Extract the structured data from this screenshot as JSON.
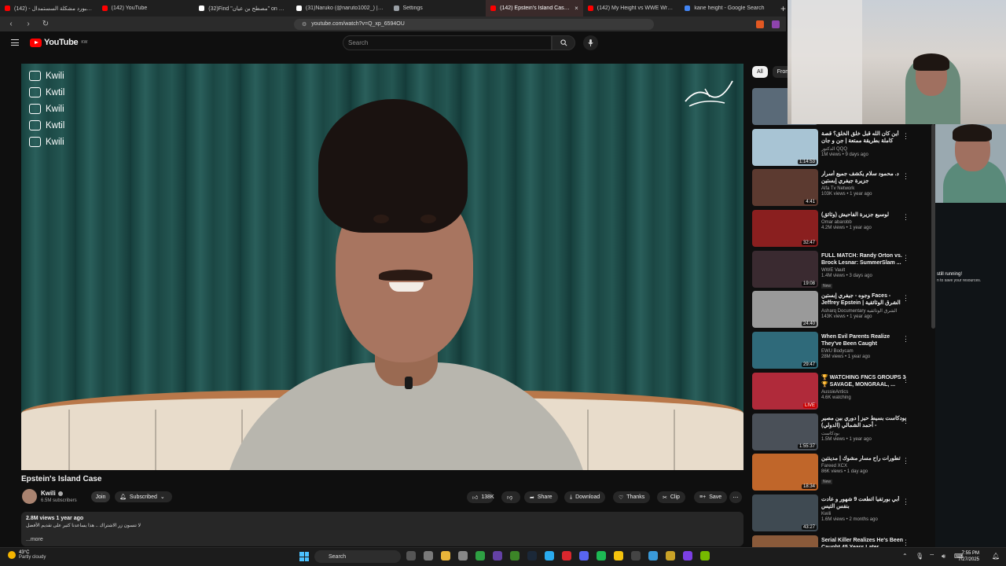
{
  "browser": {
    "tabs": [
      {
        "label": "كيبورد مشكلة السستمدال - (142) YouTube",
        "color": "#ff0000",
        "active": false
      },
      {
        "label": "(142) YouTube",
        "color": "#ff0000",
        "active": false
      },
      {
        "label": "(32)Find \"مصطح بن عيان\" on TikTok | Ti",
        "color": "#ffffff",
        "active": false
      },
      {
        "label": "(31)Naruko (@naruto1002_) | TikTok",
        "color": "#ffffff",
        "active": false
      },
      {
        "label": "Settings",
        "color": "#9aa0a6",
        "active": false
      },
      {
        "label": "(142) Epstein's Island Case - Y",
        "color": "#ff0000",
        "active": true
      },
      {
        "label": "(142) My Height vs WWE Wrestlers",
        "color": "#ff0000",
        "active": false
      },
      {
        "label": "kane height - Google Search",
        "color": "#4285f4",
        "active": false
      }
    ],
    "new_tab": "+",
    "url": "youtube.com/watch?v=Q_xp_6594OU"
  },
  "youtube": {
    "logo": "YouTube",
    "country": "KW",
    "search_placeholder": "Search",
    "video": {
      "watermark": [
        "Kwili",
        "Kwtil",
        "Kwili",
        "Kwtil",
        "Kwili"
      ],
      "watermark_icons": [
        "youtube-icon",
        "instagram-icon",
        "threads-icon",
        "twitter-icon",
        "tiktok-icon"
      ],
      "title": "Epstein's Island Case",
      "channel": "Kwili",
      "subscribers": "6.5M subscribers",
      "join": "Join",
      "subscribed": "Subscribed",
      "likes": "138K",
      "share": "Share",
      "download": "Download",
      "thanks": "Thanks",
      "clip": "Clip",
      "save": "Save",
      "views_date": "2.8M views  1 year ago",
      "description": "لا تنسون زر الاشتراك .. هذا يساعدنا كثير على تقديم الأفضل",
      "more": "...more"
    },
    "chips": [
      "All",
      "From"
    ],
    "recommendations": [
      {
        "title": "",
        "channel": "",
        "stats": "",
        "duration": "",
        "thumb": "#5a6a78",
        "badge": ""
      },
      {
        "title": "أين كان الله قبل خلق الخلق؟ قصة كاملة بطريقة ممتعة | جن و جان",
        "channel": "الدكتور QQQ",
        "stats": "1M views • 9 days ago",
        "duration": "1:14:53",
        "thumb": "#a8c4d4",
        "badge": ""
      },
      {
        "title": "د. محمود سلام يكشف جميع أسرار جزيرة جيفري إبستين",
        "channel": "Alfa Tv Network",
        "stats": "103K views • 1 year ago",
        "duration": "4:41",
        "thumb": "#5c3a30",
        "badge": ""
      },
      {
        "title": "لوسيع جزيرة الفاحيش (وثائق)",
        "channel": "Omar abarobb",
        "stats": "4.2M views • 1 year ago",
        "duration": "32:47",
        "thumb": "#8a1f1f",
        "badge": ""
      },
      {
        "title": "FULL MATCH: Randy Orton vs. Brock Lesnar: SummerSlam ...",
        "channel": "WWE Vault",
        "stats": "1.4M views • 3 days ago",
        "duration": "19:08",
        "thumb": "#3a2a30",
        "badge": "New"
      },
      {
        "title": "وجوه - جيفري إبستين Faces - Jeffrey Epstein | الشرق الوثائقية",
        "channel": "Asharq Documentary الشرق الوثائقية",
        "stats": "143K views • 1 year ago",
        "duration": "24:40",
        "thumb": "#9a9a9a",
        "badge": ""
      },
      {
        "title": "When Evil Parents Realize They've Been Caught",
        "channel": "EWU Bodycam",
        "stats": "28M views • 1 year ago",
        "duration": "29:47",
        "thumb": "#2f6a7a",
        "badge": ""
      },
      {
        "title": "🏆 WATCHING FNCS GROUPS 3 🏆 SAVAGE, MONGRAAL, ...",
        "channel": "AussieAntics",
        "stats": "4.6K watching",
        "duration": "LIVE",
        "thumb": "#b02a3a",
        "badge": ""
      },
      {
        "title": "بودكاست بسيط حيز | دوري بين مصير - أحمد الشمالي (الدولي)",
        "channel": "بودكاست",
        "stats": "1.5M views • 1 year ago",
        "duration": "1:55:37",
        "thumb": "#4a5058",
        "badge": ""
      },
      {
        "title": "تطورات راح مسار مشوك | مدينتين",
        "channel": "Fareed XCX",
        "stats": "86K views • 1 day ago",
        "duration": "18:34",
        "thumb": "#c0662a",
        "badge": "New"
      },
      {
        "title": "أبي بورتفيا اتطعت 9 شهور و عادت بنفس التيس",
        "channel": "Kwili",
        "stats": "1.6M views • 2 months ago",
        "duration": "43:27",
        "thumb": "#3f4a52",
        "badge": ""
      },
      {
        "title": "Serial Killer Realizes He's Been Caught 45 Years Later",
        "channel": "",
        "stats": "",
        "duration": "",
        "thumb": "#8a5a3a",
        "badge": ""
      }
    ]
  },
  "overlay": {
    "still_running": "still running!",
    "still_running_sub": "n to save your resources."
  },
  "taskbar": {
    "weather_temp": "43°C",
    "weather_desc": "Partly cloudy",
    "search": "Search",
    "time": "7:55 PM",
    "date": "7/27/2025"
  }
}
